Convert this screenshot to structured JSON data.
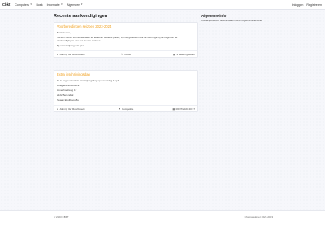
{
  "nav": {
    "brand": "Cbkt",
    "items": [
      {
        "label": "Computers",
        "has_caret": true
      },
      {
        "label": "Boek",
        "has_caret": false
      },
      {
        "label": "Informatie",
        "has_caret": true
      },
      {
        "label": "Algemeen",
        "has_caret": true
      }
    ],
    "login": "Inloggen",
    "register": "Registreren"
  },
  "main": {
    "title": "Recente aankondigingen",
    "announcements": [
      {
        "title": "Voorbereidingen seizoen 2023-2024",
        "paragraphs": [
          "Beste leden,",
          "Na een zomer vol het leerlaten en lekkeren sneeuw plaats, zijn wij gebleven ook de sommige bij de begin-on de aankondigingen van het nieuwe seizoen.",
          "Bij aanschrijving wat gaat..."
        ],
        "author": "Johnny Ver Roerbroeck",
        "category": "Clubs",
        "date": "3 weken geleden"
      },
      {
        "title": "Extra inschrijvingsdag",
        "paragraphs": [
          "Er is nog een laatste inschrijvingsdag op woensdag 12 juli",
          "Hoeglere Noetboeck",
          "Lovenhoekweg 17",
          "2122 Berendtal",
          "Twaan Ekulthoos 8u"
        ],
        "author": "Johnny Ver Roerbroeck",
        "category": "Competitie",
        "date": "06/07/2023 20:37"
      }
    ]
  },
  "sidebar": {
    "title": "Algemene info",
    "text": "Contactpersonen, bekendmaken via de reglementspersonen"
  },
  "footer": {
    "left": "© 2023 CBKT",
    "right": "Informatiekroer 2023-2023"
  }
}
